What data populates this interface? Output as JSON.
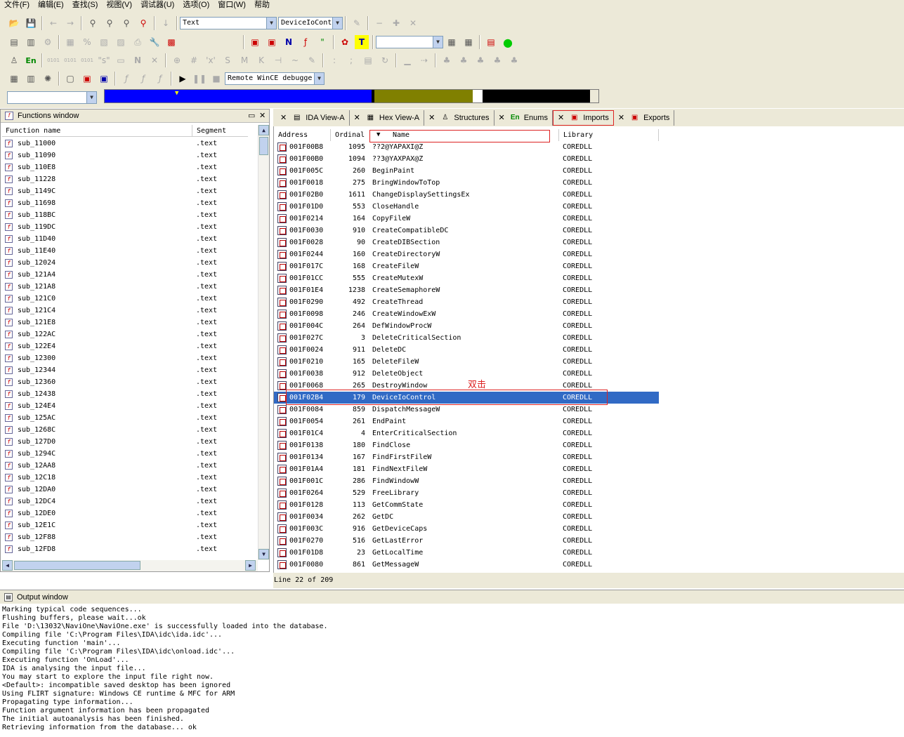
{
  "menu": [
    "文件(F)",
    "编辑(E)",
    "查找(S)",
    "视图(V)",
    "调试器(U)",
    "选项(O)",
    "窗口(W)",
    "帮助"
  ],
  "toolbar": {
    "search_type": "Text",
    "search_value": "DeviceIoCont",
    "debugger": "Remote WinCE debugge",
    "address_combo": "",
    "right_combo": ""
  },
  "colors": {
    "selection": "#316ac5",
    "annotation": "#dd2222",
    "nav_blue": "#0000ff",
    "nav_olive": "#808000"
  },
  "functions_window": {
    "title": "Functions window",
    "columns": [
      "Function name",
      "Segment"
    ],
    "rows": [
      [
        "sub_11000",
        ".text"
      ],
      [
        "sub_11090",
        ".text"
      ],
      [
        "sub_110E8",
        ".text"
      ],
      [
        "sub_11228",
        ".text"
      ],
      [
        "sub_1149C",
        ".text"
      ],
      [
        "sub_11698",
        ".text"
      ],
      [
        "sub_118BC",
        ".text"
      ],
      [
        "sub_119DC",
        ".text"
      ],
      [
        "sub_11D40",
        ".text"
      ],
      [
        "sub_11E40",
        ".text"
      ],
      [
        "sub_12024",
        ".text"
      ],
      [
        "sub_121A4",
        ".text"
      ],
      [
        "sub_121A8",
        ".text"
      ],
      [
        "sub_121C0",
        ".text"
      ],
      [
        "sub_121C4",
        ".text"
      ],
      [
        "sub_121E8",
        ".text"
      ],
      [
        "sub_122AC",
        ".text"
      ],
      [
        "sub_122E4",
        ".text"
      ],
      [
        "sub_12300",
        ".text"
      ],
      [
        "sub_12344",
        ".text"
      ],
      [
        "sub_12360",
        ".text"
      ],
      [
        "sub_12438",
        ".text"
      ],
      [
        "sub_124E4",
        ".text"
      ],
      [
        "sub_125AC",
        ".text"
      ],
      [
        "sub_1268C",
        ".text"
      ],
      [
        "sub_127D0",
        ".text"
      ],
      [
        "sub_1294C",
        ".text"
      ],
      [
        "sub_12AA8",
        ".text"
      ],
      [
        "sub_12C18",
        ".text"
      ],
      [
        "sub_12DA0",
        ".text"
      ],
      [
        "sub_12DC4",
        ".text"
      ],
      [
        "sub_12DE0",
        ".text"
      ],
      [
        "sub_12E1C",
        ".text"
      ],
      [
        "sub_12F88",
        ".text"
      ],
      [
        "sub_12FD8",
        ".text"
      ]
    ]
  },
  "tabs": [
    {
      "label": "IDA View-A",
      "icon": "▤"
    },
    {
      "label": "Hex View-A",
      "icon": "▦"
    },
    {
      "label": "Structures",
      "icon": "♙"
    },
    {
      "label": "Enums",
      "icon": "En"
    },
    {
      "label": "Imports",
      "icon": "▣"
    },
    {
      "label": "Exports",
      "icon": "▣"
    }
  ],
  "imports": {
    "columns": [
      "Address",
      "Ordinal",
      "Name",
      "Library"
    ],
    "selected_index": 21,
    "rows": [
      [
        "001F00B8",
        "1095",
        "??2@YAPAXI@Z",
        "COREDLL"
      ],
      [
        "001F00B0",
        "1094",
        "??3@YAXPAX@Z",
        "COREDLL"
      ],
      [
        "001F005C",
        "260",
        "BeginPaint",
        "COREDLL"
      ],
      [
        "001F0018",
        "275",
        "BringWindowToTop",
        "COREDLL"
      ],
      [
        "001F02B0",
        "1611",
        "ChangeDisplaySettingsEx",
        "COREDLL"
      ],
      [
        "001F01D0",
        "553",
        "CloseHandle",
        "COREDLL"
      ],
      [
        "001F0214",
        "164",
        "CopyFileW",
        "COREDLL"
      ],
      [
        "001F0030",
        "910",
        "CreateCompatibleDC",
        "COREDLL"
      ],
      [
        "001F0028",
        "90",
        "CreateDIBSection",
        "COREDLL"
      ],
      [
        "001F0244",
        "160",
        "CreateDirectoryW",
        "COREDLL"
      ],
      [
        "001F017C",
        "168",
        "CreateFileW",
        "COREDLL"
      ],
      [
        "001F01CC",
        "555",
        "CreateMutexW",
        "COREDLL"
      ],
      [
        "001F01E4",
        "1238",
        "CreateSemaphoreW",
        "COREDLL"
      ],
      [
        "001F0290",
        "492",
        "CreateThread",
        "COREDLL"
      ],
      [
        "001F0098",
        "246",
        "CreateWindowExW",
        "COREDLL"
      ],
      [
        "001F004C",
        "264",
        "DefWindowProcW",
        "COREDLL"
      ],
      [
        "001F027C",
        "3",
        "DeleteCriticalSection",
        "COREDLL"
      ],
      [
        "001F0024",
        "911",
        "DeleteDC",
        "COREDLL"
      ],
      [
        "001F0210",
        "165",
        "DeleteFileW",
        "COREDLL"
      ],
      [
        "001F0038",
        "912",
        "DeleteObject",
        "COREDLL"
      ],
      [
        "001F0068",
        "265",
        "DestroyWindow",
        "COREDLL"
      ],
      [
        "001F02B4",
        "179",
        "DeviceIoControl",
        "COREDLL"
      ],
      [
        "001F0084",
        "859",
        "DispatchMessageW",
        "COREDLL"
      ],
      [
        "001F0054",
        "261",
        "EndPaint",
        "COREDLL"
      ],
      [
        "001F01C4",
        "4",
        "EnterCriticalSection",
        "COREDLL"
      ],
      [
        "001F0138",
        "180",
        "FindClose",
        "COREDLL"
      ],
      [
        "001F0134",
        "167",
        "FindFirstFileW",
        "COREDLL"
      ],
      [
        "001F01A4",
        "181",
        "FindNextFileW",
        "COREDLL"
      ],
      [
        "001F001C",
        "286",
        "FindWindowW",
        "COREDLL"
      ],
      [
        "001F0264",
        "529",
        "FreeLibrary",
        "COREDLL"
      ],
      [
        "001F0128",
        "113",
        "GetCommState",
        "COREDLL"
      ],
      [
        "001F0034",
        "262",
        "GetDC",
        "COREDLL"
      ],
      [
        "001F003C",
        "916",
        "GetDeviceCaps",
        "COREDLL"
      ],
      [
        "001F0270",
        "516",
        "GetLastError",
        "COREDLL"
      ],
      [
        "001F01D8",
        "23",
        "GetLocalTime",
        "COREDLL"
      ],
      [
        "001F0080",
        "861",
        "GetMessageW",
        "COREDLL"
      ]
    ]
  },
  "annotation": "双击",
  "status_line": "Line 22 of 209",
  "output_window": {
    "title": "Output window",
    "lines": [
      "Marking typical code sequences...",
      "Flushing buffers, please wait...ok",
      "File 'D:\\13032\\NaviOne\\NaviOne.exe' is successfully loaded into the database.",
      "Compiling file 'C:\\Program Files\\IDA\\idc\\ida.idc'...",
      "Executing function 'main'...",
      "Compiling file 'C:\\Program Files\\IDA\\idc\\onload.idc'...",
      "Executing function 'OnLoad'...",
      "IDA is analysing the input file...",
      "You may start to explore the input file right now.",
      "<Default>: incompatible saved desktop has been ignored",
      "Using FLIRT signature: Windows CE runtime & MFC for ARM",
      "Propagating type information...",
      "Function argument information has been propagated",
      "The initial autoanalysis has been finished.",
      "Retrieving information from the database... ok"
    ]
  }
}
